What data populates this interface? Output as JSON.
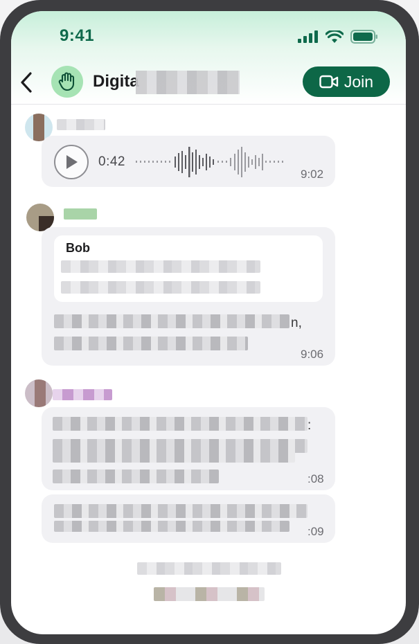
{
  "status_bar": {
    "time": "9:41"
  },
  "header": {
    "back_icon": "chevron-left-icon",
    "group_icon": "raised-hand-icon",
    "title_visible": "Digita",
    "join_label": "Join",
    "join_icon": "video-camera-icon"
  },
  "messages": [
    {
      "type": "voice",
      "duration": "0:42",
      "time": "9:02"
    },
    {
      "type": "reply",
      "quoted_author": "Bob",
      "tail_text": "n,",
      "time": "9:06"
    },
    {
      "type": "text",
      "tail_text": ":",
      "time_fragment": ":08"
    },
    {
      "type": "text",
      "time_fragment": ":09"
    }
  ],
  "colors": {
    "brand_green": "#0d6747",
    "header_gradient_top": "#c7efda",
    "bubble_bg": "#f1f1f4"
  }
}
